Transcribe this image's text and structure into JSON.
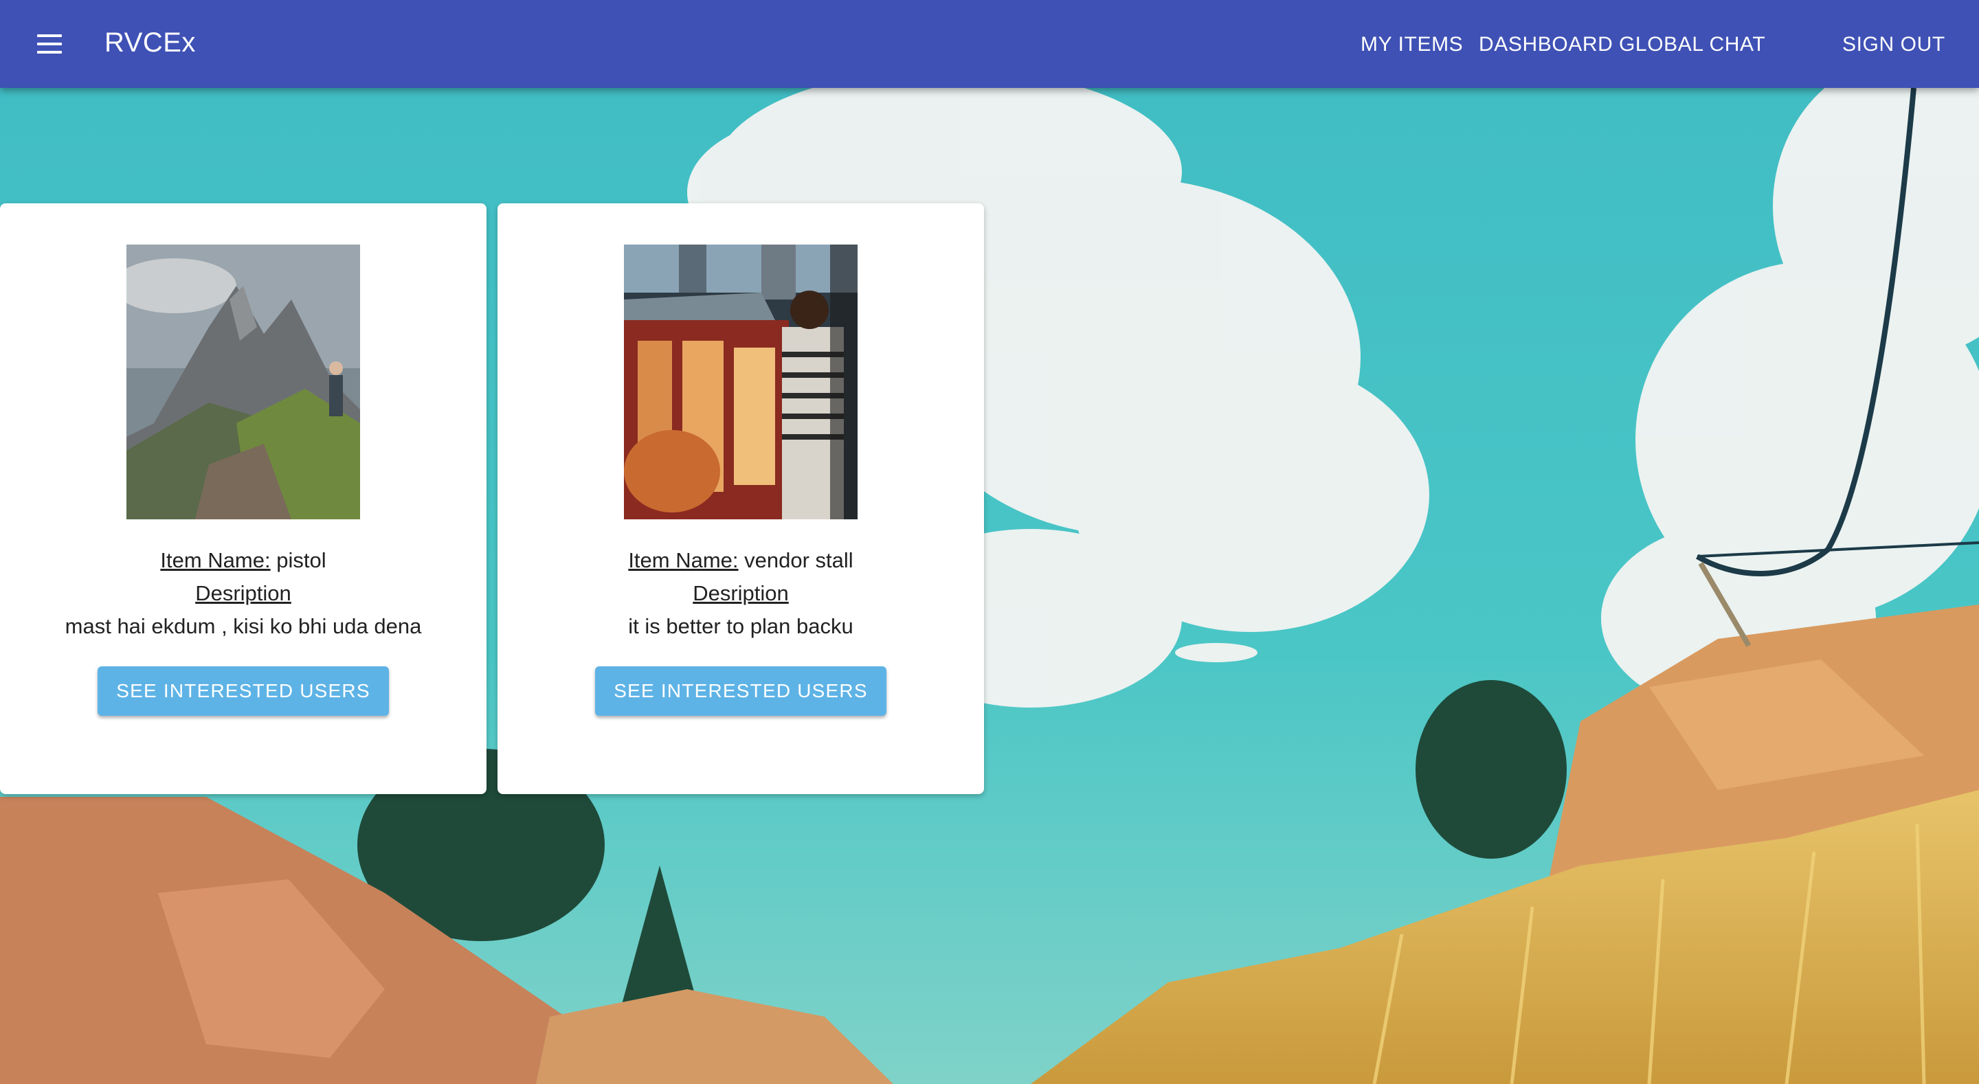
{
  "app": {
    "brand": "RVCEx",
    "nav": {
      "my_items": "MY ITEMS",
      "dashboard": "DASHBOARD",
      "global_chat": "GLOBAL CHAT",
      "sign_out": "SIGN OUT"
    }
  },
  "items": [
    {
      "name_label": "Item Name:",
      "name": "pistol",
      "description_label": "Desription",
      "description": "mast hai ekdum , kisi ko bhi uda dena",
      "button_label": "SEE INTERESTED USERS"
    },
    {
      "name_label": "Item Name:",
      "name": "vendor stall",
      "description_label": "Desription",
      "description": "it is better to plan backu",
      "button_label": "SEE INTERESTED USERS"
    }
  ],
  "colors": {
    "appbar": "#3f51b5",
    "button": "#5eb3e6",
    "sky": "#45c3c5"
  }
}
